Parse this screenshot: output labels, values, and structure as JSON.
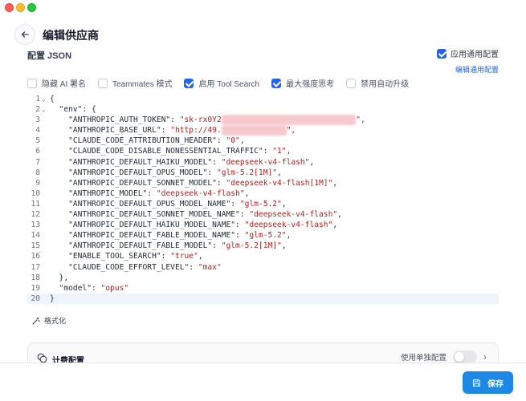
{
  "header": {
    "title": "编辑供应商"
  },
  "config": {
    "section_label": "配置 JSON",
    "general_config_label": "应用通用配置",
    "general_config_checked": true,
    "edit_general_link": "编辑通用配置"
  },
  "options": [
    {
      "label": "隐藏 AI 署名",
      "checked": false
    },
    {
      "label": "Teammates 模式",
      "checked": false
    },
    {
      "label": "启用 Tool Search",
      "checked": true
    },
    {
      "label": "最大强度思考",
      "checked": true
    },
    {
      "label": "禁用自动升级",
      "checked": false
    }
  ],
  "editor": {
    "active_line": 20,
    "lines": [
      {
        "n": "1",
        "fold": "⌄",
        "parts": [
          [
            "p",
            "{"
          ]
        ]
      },
      {
        "n": "2",
        "fold": "⌄",
        "parts": [
          [
            "p",
            "  \"env\": {"
          ]
        ]
      },
      {
        "n": "3",
        "fold": "",
        "parts": [
          [
            "k",
            "    \"ANTHROPIC_AUTH_TOKEN\": "
          ],
          [
            "s",
            "\"sk-rx0Y2"
          ],
          [
            "b",
            "xxxxxxxxxxxxxxxxxxxxxxxxxxxxx"
          ],
          [
            "s",
            "\","
          ]
        ]
      },
      {
        "n": "4",
        "fold": "",
        "parts": [
          [
            "k",
            "    \"ANTHROPIC_BASE_URL\": "
          ],
          [
            "s",
            "\"http://49."
          ],
          [
            "b",
            "xxxxxxxxxxxxxx"
          ],
          [
            "s",
            "\","
          ]
        ]
      },
      {
        "n": "5",
        "fold": "",
        "parts": [
          [
            "k",
            "    \"CLAUDE_CODE_ATTRIBUTION_HEADER\": "
          ],
          [
            "s",
            "\"0\""
          ],
          [
            "p",
            ","
          ]
        ]
      },
      {
        "n": "6",
        "fold": "",
        "parts": [
          [
            "k",
            "    \"CLAUDE_CODE_DISABLE_NONESSENTIAL_TRAFFIC\": "
          ],
          [
            "s",
            "\"1\""
          ],
          [
            "p",
            ","
          ]
        ]
      },
      {
        "n": "7",
        "fold": "",
        "parts": [
          [
            "k",
            "    \"ANTHROPIC_DEFAULT_HAIKU_MODEL\": "
          ],
          [
            "s",
            "\"deepseek-v4-flash\""
          ],
          [
            "p",
            ","
          ]
        ]
      },
      {
        "n": "8",
        "fold": "",
        "parts": [
          [
            "k",
            "    \"ANTHROPIC_DEFAULT_OPUS_MODEL\": "
          ],
          [
            "s",
            "\"glm-5.2[1M]\""
          ],
          [
            "p",
            ","
          ]
        ]
      },
      {
        "n": "9",
        "fold": "",
        "parts": [
          [
            "k",
            "    \"ANTHROPIC_DEFAULT_SONNET_MODEL\": "
          ],
          [
            "s",
            "\"deepseek-v4-flash[1M]\""
          ],
          [
            "p",
            ","
          ]
        ]
      },
      {
        "n": "10",
        "fold": "",
        "parts": [
          [
            "k",
            "    \"ANTHROPIC_MODEL\": "
          ],
          [
            "s",
            "\"deepseek-v4-flash\""
          ],
          [
            "p",
            ","
          ]
        ]
      },
      {
        "n": "11",
        "fold": "",
        "parts": [
          [
            "k",
            "    \"ANTHROPIC_DEFAULT_OPUS_MODEL_NAME\": "
          ],
          [
            "s",
            "\"glm-5.2\""
          ],
          [
            "p",
            ","
          ]
        ]
      },
      {
        "n": "12",
        "fold": "",
        "parts": [
          [
            "k",
            "    \"ANTHROPIC_DEFAULT_SONNET_MODEL_NAME\": "
          ],
          [
            "s",
            "\"deepseek-v4-flash\""
          ],
          [
            "p",
            ","
          ]
        ]
      },
      {
        "n": "13",
        "fold": "",
        "parts": [
          [
            "k",
            "    \"ANTHROPIC_DEFAULT_HAIKU_MODEL_NAME\": "
          ],
          [
            "s",
            "\"deepseek-v4-flash\""
          ],
          [
            "p",
            ","
          ]
        ]
      },
      {
        "n": "14",
        "fold": "",
        "parts": [
          [
            "k",
            "    \"ANTHROPIC_DEFAULT_FABLE_MODEL_NAME\": "
          ],
          [
            "s",
            "\"glm-5.2\""
          ],
          [
            "p",
            ","
          ]
        ]
      },
      {
        "n": "15",
        "fold": "",
        "parts": [
          [
            "k",
            "    \"ANTHROPIC_DEFAULT_FABLE_MODEL\": "
          ],
          [
            "s",
            "\"glm-5.2[1M]\""
          ],
          [
            "p",
            ","
          ]
        ]
      },
      {
        "n": "16",
        "fold": "",
        "parts": [
          [
            "k",
            "    \"ENABLE_TOOL_SEARCH\": "
          ],
          [
            "s",
            "\"true\""
          ],
          [
            "p",
            ","
          ]
        ]
      },
      {
        "n": "17",
        "fold": "",
        "parts": [
          [
            "k",
            "    \"CLAUDE_CODE_EFFORT_LEVEL\": "
          ],
          [
            "s",
            "\"max\""
          ]
        ]
      },
      {
        "n": "18",
        "fold": "",
        "parts": [
          [
            "p",
            "  },"
          ]
        ]
      },
      {
        "n": "19",
        "fold": "",
        "parts": [
          [
            "k",
            "  \"model\": "
          ],
          [
            "s",
            "\"opus\""
          ]
        ]
      },
      {
        "n": "20",
        "fold": "",
        "parts": [
          [
            "p",
            "}"
          ]
        ]
      }
    ]
  },
  "format_label": "格式化",
  "billing": {
    "title": "计费配置",
    "toggle_label": "使用单独配置",
    "toggle_on": false
  },
  "footer": {
    "save_label": "保存"
  },
  "colors": {
    "accent": "#2563eb",
    "save": "#1e88e5",
    "string": "#b91c1c"
  }
}
